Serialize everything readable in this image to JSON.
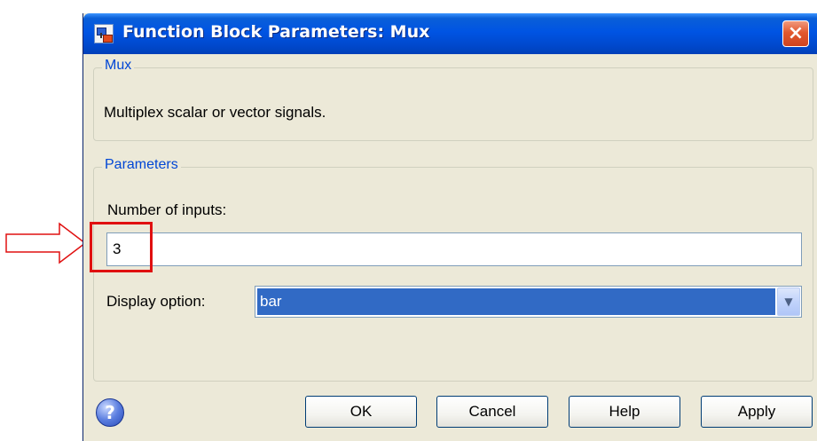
{
  "window": {
    "title": "Function Block Parameters: Mux",
    "close_label": "×"
  },
  "description_group": {
    "legend": "Mux",
    "text": "Multiplex scalar or vector signals."
  },
  "parameters_group": {
    "legend": "Parameters",
    "number_of_inputs_label": "Number of inputs:",
    "number_of_inputs_value": "3",
    "display_option_label": "Display option:",
    "display_option_value": "bar"
  },
  "buttons": {
    "ok": "OK",
    "cancel": "Cancel",
    "help": "Help",
    "apply": "Apply"
  },
  "help_icon_glyph": "?",
  "icons": [
    "simulink-block-icon",
    "close-icon",
    "chevron-down-icon",
    "help-icon",
    "arrow-right-icon"
  ],
  "colors": {
    "titlebar": "#0054e3",
    "legend": "#0046d5",
    "selection": "#316ac5",
    "annotation": "#e01010"
  }
}
